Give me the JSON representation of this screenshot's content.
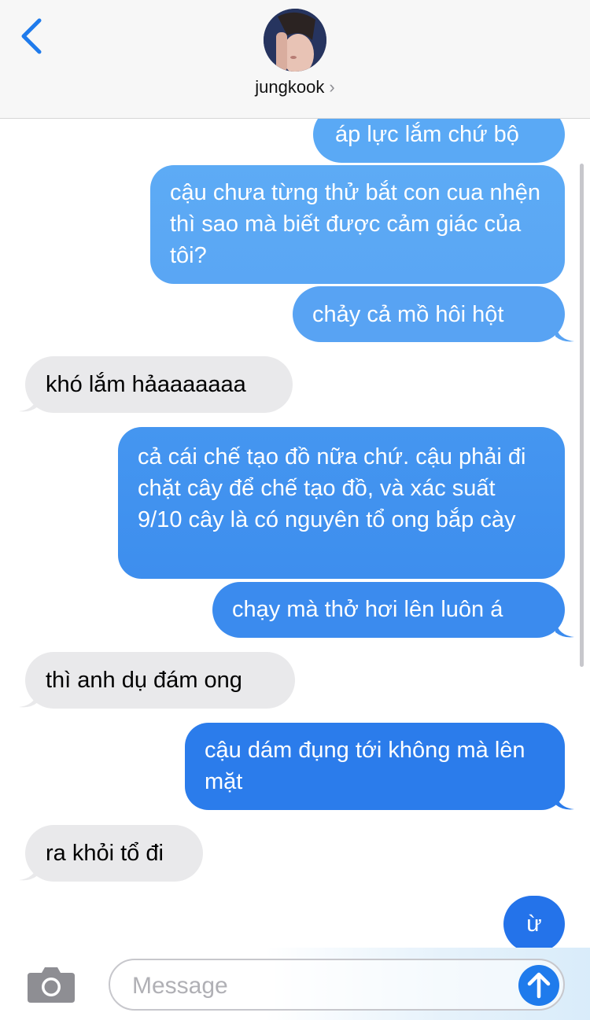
{
  "header": {
    "contact_name": "jungkook",
    "chevron": "›"
  },
  "messages": [
    {
      "direction": "sent",
      "text": "áp lực lắm chứ bộ"
    },
    {
      "direction": "sent",
      "text": "cậu chưa từng thử bắt con cua nhện thì sao mà biết được cảm giác của tôi?"
    },
    {
      "direction": "sent",
      "text": "chảy cả mồ hôi hột"
    },
    {
      "direction": "received",
      "text": "khó lắm hảaaaaaaa"
    },
    {
      "direction": "sent",
      "text": "cả cái chế tạo đồ nữa chứ. cậu phải đi chặt cây để chế tạo đồ, và xác suất 9/10 cây là có nguyên tổ ong bắp cày"
    },
    {
      "direction": "sent",
      "text": "chạy mà thở hơi lên luôn á"
    },
    {
      "direction": "received",
      "text": "thì anh dụ đám ong"
    },
    {
      "direction": "sent",
      "text": "cậu dám đụng tới không mà lên mặt"
    },
    {
      "direction": "received",
      "text": "ra khỏi tổ đi"
    },
    {
      "direction": "sent",
      "text": "ừ"
    }
  ],
  "input": {
    "placeholder": "Message"
  },
  "icons": {
    "back": "chevron-left-icon",
    "camera": "camera-icon",
    "send": "arrow-up-icon"
  },
  "colors": {
    "sent_top": "#5aa9f5",
    "sent_bottom": "#1f6ee6",
    "received": "#e9e9eb",
    "accent": "#1f7bec"
  }
}
